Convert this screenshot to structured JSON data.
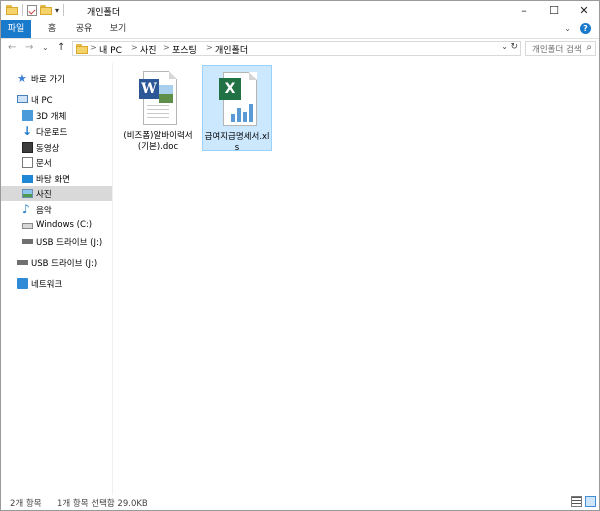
{
  "window": {
    "title": "개인폴더",
    "controls": {
      "minimize": "–",
      "maximize": "☐",
      "close": "✕"
    }
  },
  "quick_access": {
    "dropdown": "▾"
  },
  "ribbon": {
    "tabs": [
      "파일",
      "홈",
      "공유",
      "보기"
    ],
    "expand": "⌄",
    "help": "?"
  },
  "nav": {
    "back": "←",
    "forward": "→",
    "recent": "⌄",
    "up": "↑"
  },
  "address": {
    "sep": ">",
    "crumbs": [
      "내 PC",
      "사진",
      "포스팅",
      "개인폴더"
    ],
    "dropdown": "⌄",
    "refresh": "↻"
  },
  "search": {
    "placeholder": "개인폴더 검색",
    "icon": "search-icon"
  },
  "sidebar": {
    "items": [
      {
        "label": "바로 가기",
        "icon": "star-icon"
      },
      {
        "label": "내 PC",
        "icon": "pc-icon"
      },
      {
        "label": "3D 개체",
        "icon": "cube-icon"
      },
      {
        "label": "다운로드",
        "icon": "download-icon"
      },
      {
        "label": "동영상",
        "icon": "video-icon"
      },
      {
        "label": "문서",
        "icon": "document-icon"
      },
      {
        "label": "바탕 화면",
        "icon": "desktop-icon"
      },
      {
        "label": "사진",
        "icon": "pictures-icon"
      },
      {
        "label": "음악",
        "icon": "music-icon"
      },
      {
        "label": "Windows (C:)",
        "icon": "drive-icon"
      },
      {
        "label": "USB 드라이브 (J:)",
        "icon": "usb-drive-icon"
      },
      {
        "label": "USB 드라이브 (J:)",
        "icon": "usb-drive-icon"
      },
      {
        "label": "네트워크",
        "icon": "network-icon"
      }
    ]
  },
  "files": [
    {
      "name": "(비즈폼)알바이력서(기본).doc",
      "icon_letter": "W",
      "type": "word"
    },
    {
      "name": "급여지급명세서.xls",
      "icon_letter": "X",
      "type": "excel"
    }
  ],
  "status": {
    "count": "2개 항목",
    "selection": "1개 항목 선택함 29.0KB"
  },
  "colors": {
    "accent": "#1979ca",
    "selected_bg": "#cce8ff",
    "nav_selected_bg": "#d9d9d9",
    "word": "#2b5797",
    "excel": "#207245"
  }
}
